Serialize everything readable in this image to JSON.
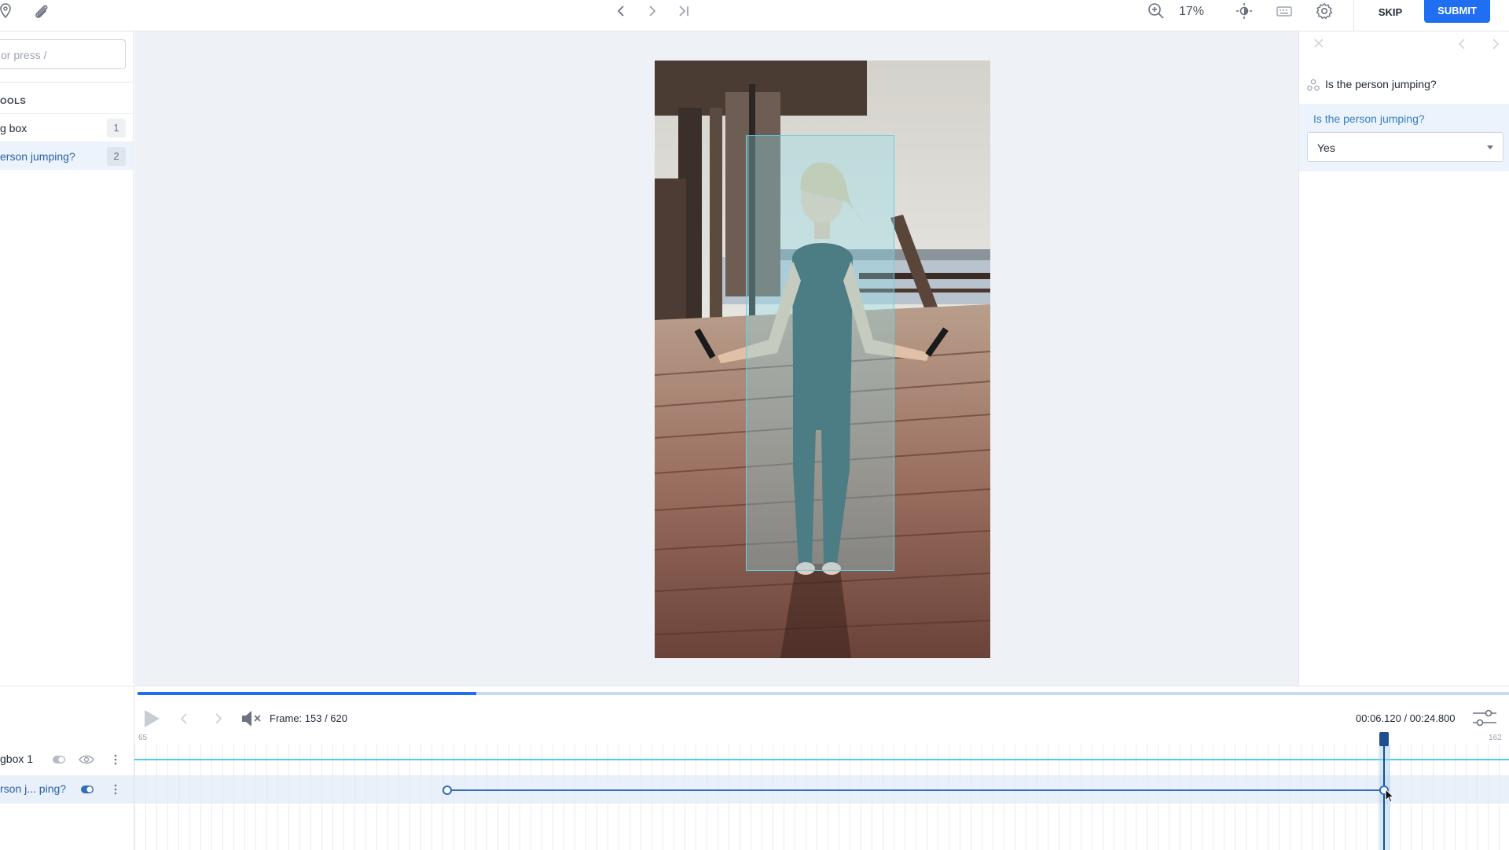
{
  "topbar": {
    "zoom_value": "17%",
    "skip_label": "SKIP",
    "submit_label": "SUBMIT",
    "icons": [
      "location-pin-icon",
      "attachment-icon",
      "chevron-left-icon",
      "chevron-right-icon",
      "skip-to-end-icon",
      "zoom-in-icon",
      "brightness-icon",
      "keyboard-icon",
      "gear-icon"
    ]
  },
  "left_panel": {
    "search_placeholder": "or press /",
    "tools_heading": "OOLS",
    "tools": [
      {
        "label": "g box",
        "count": "1"
      },
      {
        "label": "erson jumping?",
        "count": "2"
      }
    ]
  },
  "right_panel": {
    "question_title": "Is the person jumping?",
    "card_label": "Is the person jumping?",
    "selected_answer": "Yes"
  },
  "timeline": {
    "progress_fraction": 0.247,
    "frame_text": "Frame: 153 / 620",
    "time_text": "00:06.120 / 00:24.800",
    "tick_start": "65",
    "tick_end": "162",
    "rows": [
      {
        "label": "gbox 1"
      },
      {
        "label": "rson j...  ping?"
      }
    ]
  },
  "colors": {
    "accent": "#1f6ff0",
    "bbox_fill": "#8ce1f0",
    "bbox_border": "#63cfe6",
    "active_row_bg": "#edf3fc",
    "timeline_line": "#2f6dbf"
  }
}
